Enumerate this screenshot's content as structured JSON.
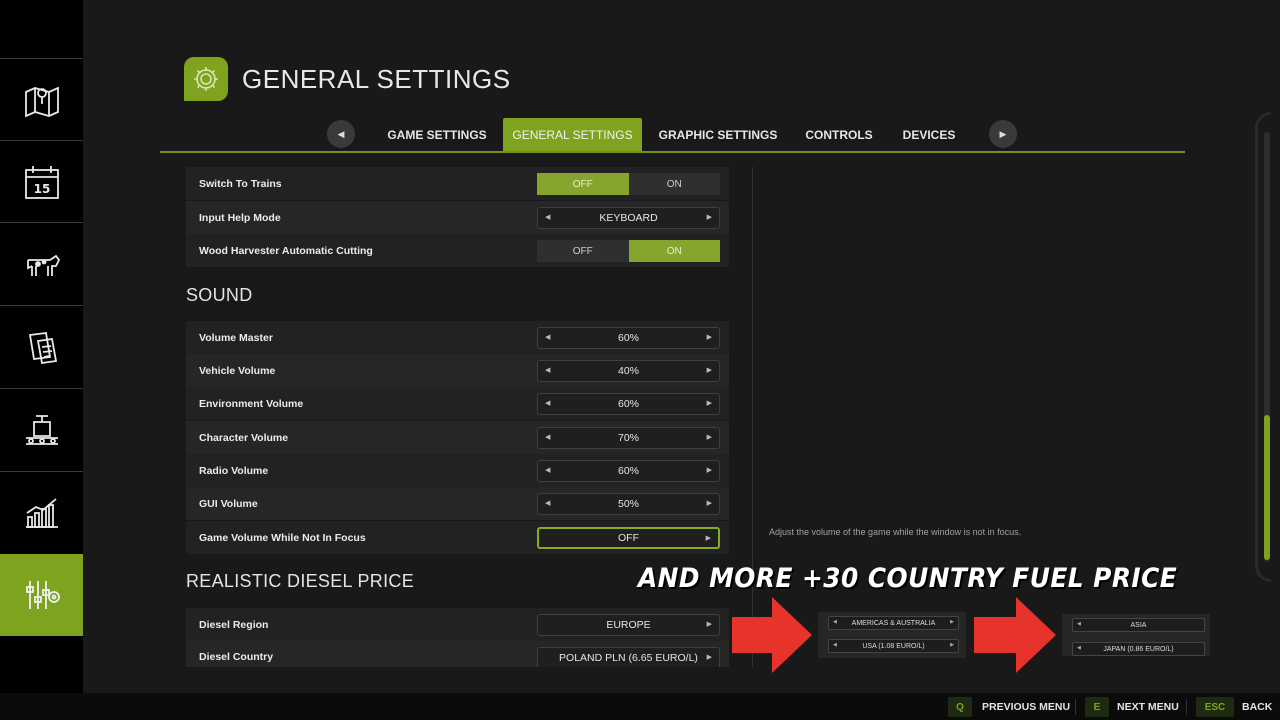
{
  "header": {
    "title": "GENERAL SETTINGS",
    "icon": "gear-icon"
  },
  "tabs": [
    {
      "label": "GAME SETTINGS",
      "active": false
    },
    {
      "label": "GENERAL SETTINGS",
      "active": true
    },
    {
      "label": "GRAPHIC SETTINGS",
      "active": false
    },
    {
      "label": "CONTROLS",
      "active": false
    },
    {
      "label": "DEVICES",
      "active": false
    }
  ],
  "sidebar": {
    "items": [
      {
        "icon": "map-icon"
      },
      {
        "icon": "calendar-icon",
        "day": "15"
      },
      {
        "icon": "cow-icon"
      },
      {
        "icon": "contracts-icon"
      },
      {
        "icon": "production-icon"
      },
      {
        "icon": "statistics-icon"
      },
      {
        "icon": "settings-sliders-icon",
        "active": true
      }
    ]
  },
  "rows_top": [
    {
      "label": "Switch To Trains",
      "type": "toggle",
      "off": "OFF",
      "on": "ON",
      "selected": "OFF"
    },
    {
      "label": "Input Help Mode",
      "type": "selector",
      "value": "KEYBOARD"
    },
    {
      "label": "Wood Harvester Automatic Cutting",
      "type": "toggle",
      "off": "OFF",
      "on": "ON",
      "selected": "ON"
    }
  ],
  "sound": {
    "title": "SOUND",
    "rows": [
      {
        "label": "Volume Master",
        "value": "60%"
      },
      {
        "label": "Vehicle Volume",
        "value": "40%"
      },
      {
        "label": "Environment Volume",
        "value": "60%"
      },
      {
        "label": "Character Volume",
        "value": "70%"
      },
      {
        "label": "Radio Volume",
        "value": "60%"
      },
      {
        "label": "GUI Volume",
        "value": "50%"
      },
      {
        "label": "Game Volume While Not In Focus",
        "value": "OFF"
      }
    ]
  },
  "diesel": {
    "title": "REALISTIC DIESEL PRICE",
    "rows": [
      {
        "label": "Diesel Region",
        "value": "EUROPE"
      },
      {
        "label": "Diesel Country",
        "value": "POLAND PLN (6.65 EURO/L)"
      }
    ]
  },
  "help_text": "Adjust the volume of the game while the window is not in focus.",
  "promo": {
    "title": "AND MORE +30 COUNTRY FUEL PRICE",
    "arrow_color": "#e8322c",
    "box1": {
      "region": "AMERICAS & AUSTRALIA",
      "country": "USA (1.08 EURO/L)"
    },
    "box2": {
      "region": "ASIA",
      "country": "JAPAN (0.86 EURO/L)"
    }
  },
  "bottom_bar": [
    {
      "key": "Q",
      "label": "PREVIOUS MENU"
    },
    {
      "key": "E",
      "label": "NEXT MENU"
    },
    {
      "key": "ESC",
      "label": "BACK"
    }
  ],
  "colors": {
    "accent": "#7ea31e",
    "panel": "#191919",
    "sidebar": "#000000"
  }
}
